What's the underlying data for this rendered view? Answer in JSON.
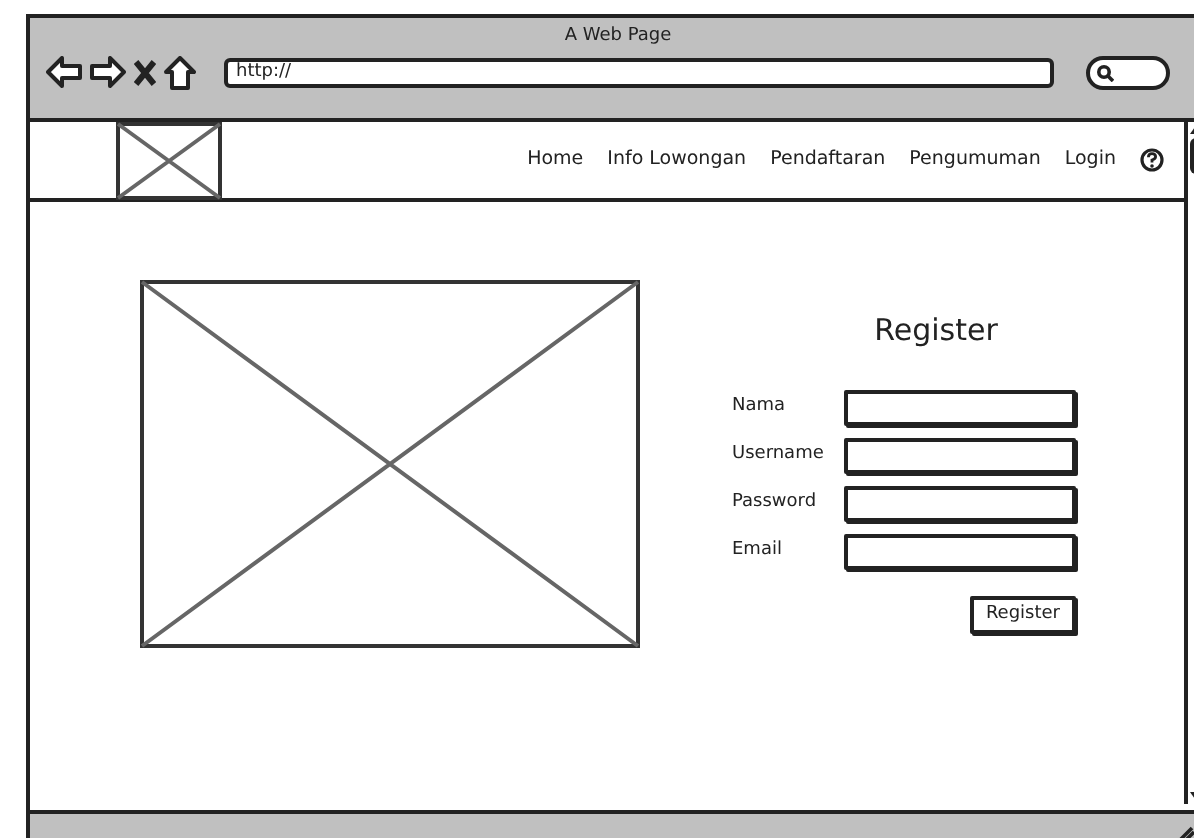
{
  "window": {
    "title": "A Web Page"
  },
  "address_bar": {
    "value": "http://"
  },
  "nav": {
    "items": [
      {
        "label": "Home"
      },
      {
        "label": "Info Lowongan"
      },
      {
        "label": "Pendaftaran"
      },
      {
        "label": "Pengumuman"
      },
      {
        "label": "Login"
      }
    ]
  },
  "form": {
    "title": "Register",
    "fields": [
      {
        "label": "Nama"
      },
      {
        "label": "Username"
      },
      {
        "label": "Password"
      },
      {
        "label": "Email"
      }
    ],
    "button": "Register"
  }
}
